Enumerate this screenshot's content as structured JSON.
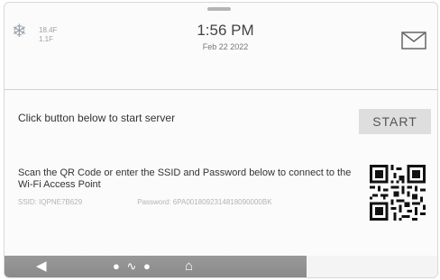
{
  "status": {
    "weather_temps": [
      "18.4F",
      "1.1F"
    ],
    "weather_icon": "snowflake-icon",
    "time": "1:56 PM",
    "date": "Feb 22 2022",
    "mail_icon": "envelope-icon"
  },
  "server": {
    "prompt": "Click button below to start server",
    "start_label": "START"
  },
  "access_point": {
    "instructions": "Scan the QR Code or enter the SSID and Password below to connect to the Wi-Fi Access Point",
    "ssid_text": "SSID: IQPNE7B629",
    "password_text": "Password: 6PA0018092314818090000BK"
  },
  "nav": {
    "icons": [
      "back-arrow-icon",
      "security-icon",
      "home-icon"
    ]
  }
}
